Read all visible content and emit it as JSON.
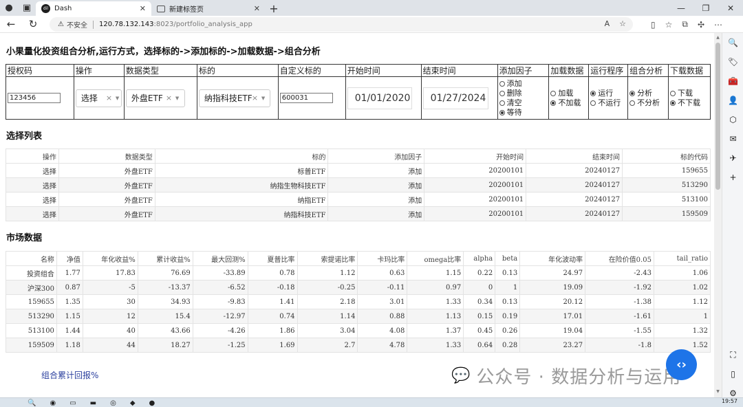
{
  "browser": {
    "tabs": [
      {
        "title": "Dash",
        "active": true
      },
      {
        "title": "新建标签页",
        "active": false
      }
    ],
    "security_label": "不安全",
    "url_host": "120.78.132.143",
    "url_path": ":8023/portfolio_analysis_app"
  },
  "page": {
    "title": "小果量化投资组合分析,运行方式，选择标的->添加标的->加载数据->组合分析",
    "controls": {
      "headers": [
        "授权码",
        "操作",
        "数据类型",
        "标的",
        "自定义标的",
        "开始时间",
        "结束时间",
        "添加因子",
        "加载数据",
        "运行程序",
        "组合分析",
        "下载数据"
      ],
      "auth_code": "123456",
      "operation": "选择",
      "data_type": "外盘ETF",
      "target": "纳指科技ETF",
      "custom_target": "600031",
      "start_date": "01/01/2020",
      "end_date": "01/27/2024",
      "factor_options": [
        {
          "label": "添加",
          "selected": false
        },
        {
          "label": "删除",
          "selected": false
        },
        {
          "label": "清空",
          "selected": false
        },
        {
          "label": "等待",
          "selected": true
        }
      ],
      "load_options": [
        {
          "label": "加载",
          "selected": false
        },
        {
          "label": "不加载",
          "selected": true
        }
      ],
      "run_options": [
        {
          "label": "运行",
          "selected": true
        },
        {
          "label": "不运行",
          "selected": false
        }
      ],
      "analysis_options": [
        {
          "label": "分析",
          "selected": true
        },
        {
          "label": "不分析",
          "selected": false
        }
      ],
      "download_options": [
        {
          "label": "下载",
          "selected": false
        },
        {
          "label": "不下载",
          "selected": true
        }
      ]
    },
    "selection": {
      "title": "选择列表",
      "columns": [
        "操作",
        "数据类型",
        "标的",
        "添加因子",
        "开始时间",
        "结束时间",
        "标的代码"
      ],
      "rows": [
        [
          "选择",
          "外盘ETF",
          "标普ETF",
          "添加",
          "20200101",
          "20240127",
          "159655"
        ],
        [
          "选择",
          "外盘ETF",
          "纳指生物科技ETF",
          "添加",
          "20200101",
          "20240127",
          "513290"
        ],
        [
          "选择",
          "外盘ETF",
          "纳指ETF",
          "添加",
          "20200101",
          "20240127",
          "513100"
        ],
        [
          "选择",
          "外盘ETF",
          "纳指科技ETF",
          "添加",
          "20200101",
          "20240127",
          "159509"
        ]
      ]
    },
    "market": {
      "title": "市场数据",
      "columns": [
        "名称",
        "净值",
        "年化收益%",
        "累计收益%",
        "最大回测%",
        "夏普比率",
        "索提诺比率",
        "卡玛比率",
        "omega比率",
        "alpha",
        "beta",
        "年化波动率",
        "在险价值0.05",
        "tail_ratio"
      ],
      "rows": [
        [
          "投资组合",
          "1.77",
          "17.83",
          "76.69",
          "-33.89",
          "0.78",
          "1.12",
          "0.63",
          "1.15",
          "0.22",
          "0.13",
          "24.97",
          "-2.43",
          "1.06"
        ],
        [
          "沪深300",
          "0.87",
          "-5",
          "-13.37",
          "-6.52",
          "-0.18",
          "-0.25",
          "-0.11",
          "0.97",
          "0",
          "1",
          "19.09",
          "-1.92",
          "1.02"
        ],
        [
          "159655",
          "1.35",
          "30",
          "34.93",
          "-9.83",
          "1.41",
          "2.18",
          "3.01",
          "1.33",
          "0.34",
          "0.13",
          "20.12",
          "-1.38",
          "1.12"
        ],
        [
          "513290",
          "1.15",
          "12",
          "15.4",
          "-12.97",
          "0.74",
          "1.14",
          "0.88",
          "1.13",
          "0.15",
          "0.19",
          "17.01",
          "-1.61",
          "1"
        ],
        [
          "513100",
          "1.44",
          "40",
          "43.66",
          "-4.26",
          "1.86",
          "3.04",
          "4.08",
          "1.37",
          "0.45",
          "0.26",
          "19.04",
          "-1.55",
          "1.32"
        ],
        [
          "159509",
          "1.18",
          "44",
          "18.27",
          "-1.25",
          "1.69",
          "2.7",
          "4.78",
          "1.33",
          "0.64",
          "0.28",
          "23.27",
          "-1.8",
          "1.52"
        ]
      ]
    },
    "cumulative_title": "组合累计回报%",
    "watermark": "公众号 · 数据分析与运用",
    "taskbar_time": "19:57"
  }
}
